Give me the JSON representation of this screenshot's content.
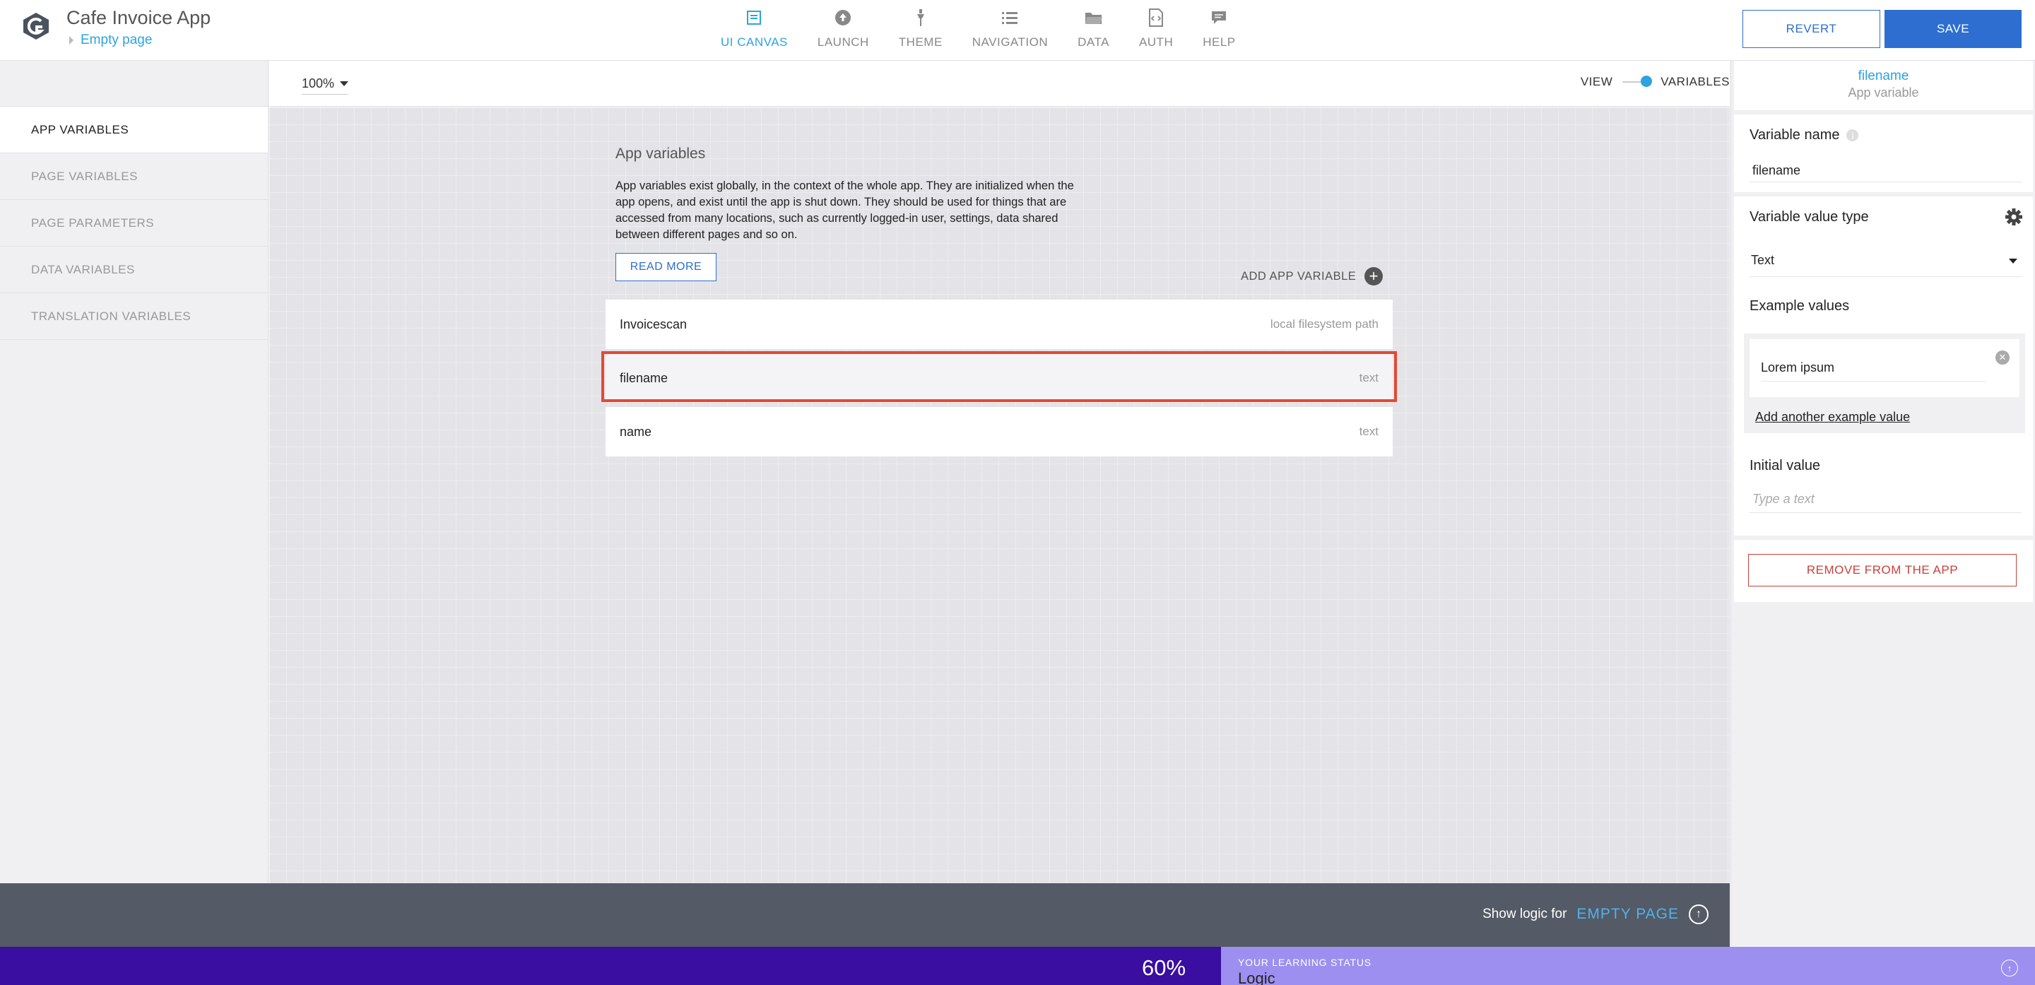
{
  "app": {
    "title": "Cafe Invoice App",
    "current_page": "Empty page"
  },
  "nav": {
    "items": [
      {
        "label": "UI CANVAS",
        "icon": "ui-canvas-icon",
        "active": true
      },
      {
        "label": "LAUNCH",
        "icon": "launch-icon",
        "active": false
      },
      {
        "label": "THEME",
        "icon": "theme-icon",
        "active": false
      },
      {
        "label": "NAVIGATION",
        "icon": "navigation-icon",
        "active": false
      },
      {
        "label": "DATA",
        "icon": "data-folder-icon",
        "active": false
      },
      {
        "label": "AUTH",
        "icon": "auth-icon",
        "active": false
      },
      {
        "label": "HELP",
        "icon": "help-icon",
        "active": false
      }
    ]
  },
  "header": {
    "revert_label": "REVERT",
    "save_label": "SAVE"
  },
  "sidebar": {
    "items": [
      {
        "label": "APP VARIABLES",
        "active": true
      },
      {
        "label": "PAGE VARIABLES",
        "active": false
      },
      {
        "label": "PAGE PARAMETERS",
        "active": false
      },
      {
        "label": "DATA VARIABLES",
        "active": false
      },
      {
        "label": "TRANSLATION VARIABLES",
        "active": false
      }
    ]
  },
  "toolbar": {
    "zoom": "100%",
    "view_label": "VIEW",
    "variables_label": "VARIABLES"
  },
  "canvas": {
    "title": "App variables",
    "description": "App variables exist globally, in the context of the whole app. They are initialized when the app opens, and exist until the app is shut down. They should be used for things that are accessed from many locations, such as currently logged-in user, settings, data shared between different pages and so on.",
    "read_more_label": "READ MORE",
    "add_variable_label": "ADD APP VARIABLE",
    "variables": [
      {
        "name": "Invoicescan",
        "type": "local filesystem path"
      },
      {
        "name": "filename",
        "type": "text"
      },
      {
        "name": "name",
        "type": "text"
      }
    ]
  },
  "logic_bar": {
    "show_logic_for": "Show logic for",
    "page": "EMPTY PAGE"
  },
  "learning": {
    "percent": "60%",
    "label": "YOUR LEARNING STATUS",
    "topic": "Logic"
  },
  "right_panel": {
    "selected_name": "filename",
    "selected_kind": "App variable",
    "variable_name_label": "Variable name",
    "variable_name_value": "filename",
    "value_type_label": "Variable value type",
    "value_type": "Text",
    "example_values_label": "Example values",
    "example_value": "Lorem ipsum",
    "add_example_label": "Add another example value",
    "initial_value_label": "Initial value",
    "initial_value_placeholder": "Type a text",
    "remove_label": "REMOVE FROM THE APP"
  },
  "colors": {
    "accent_blue": "#2ba4e0",
    "button_blue": "#2d6ed0",
    "highlight_red": "#e14a35",
    "danger": "#c9403a",
    "logic_bar": "#545a66",
    "learning_dark": "#3a0ea0",
    "learning_light": "#9d8ff0"
  }
}
